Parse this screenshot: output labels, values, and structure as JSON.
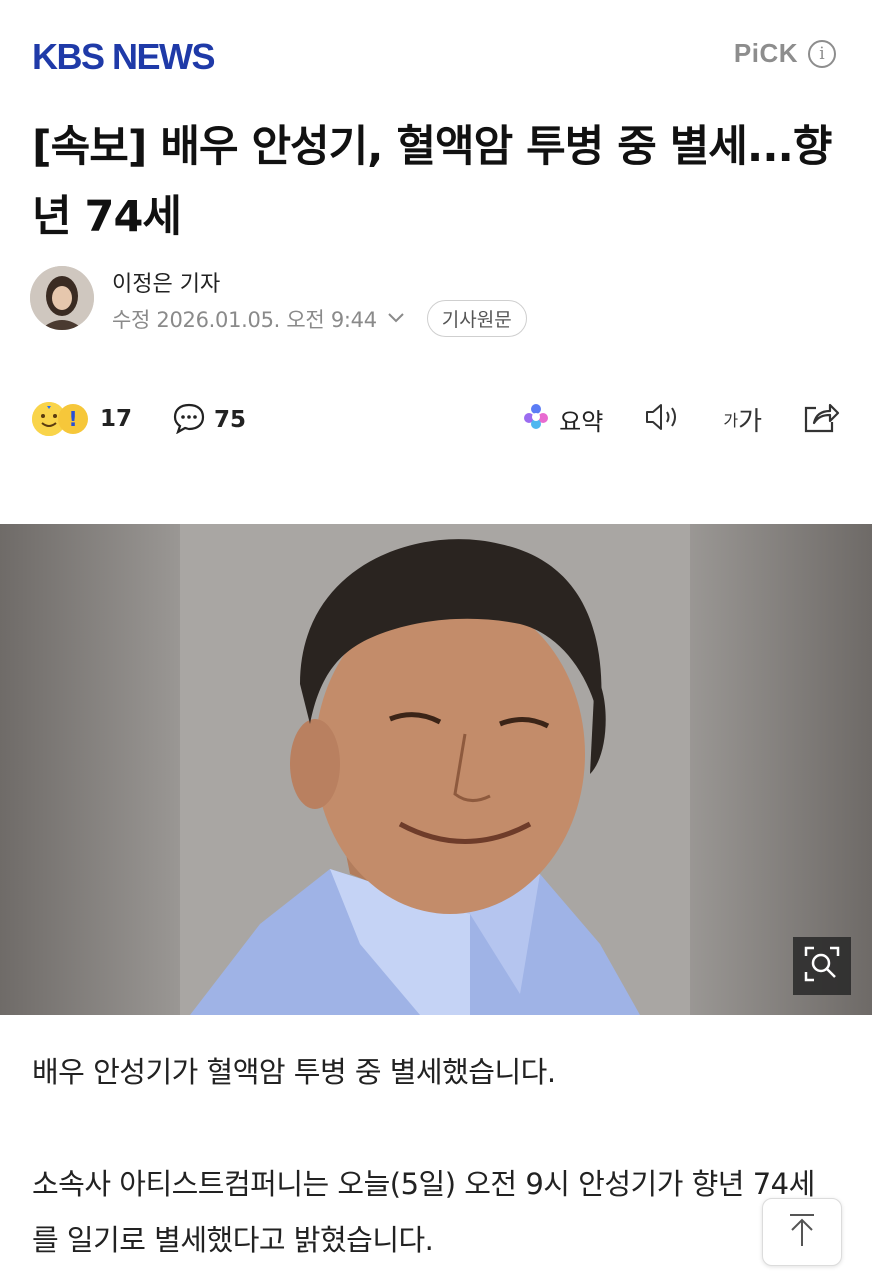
{
  "header": {
    "logo": "KBS NEWS",
    "pick_label": "PiCK",
    "info_icon": "info-icon"
  },
  "article": {
    "headline": "[속보] 배우 안성기, 혈액암 투병 중 별세...향년 74세",
    "reporter": "이정은 기자",
    "modified": "수정 2026.01.05. 오전 9:44",
    "origin_button": "기사원문"
  },
  "actions": {
    "reaction_count": "17",
    "comment_count": "75",
    "summary_label": "요약",
    "font_small": "가",
    "font_large": "가",
    "icons": [
      "reaction-emoji-icon",
      "comment-icon",
      "ai-summary-icon",
      "speaker-icon",
      "share-icon"
    ]
  },
  "photo": {
    "zoom_icon": "zoom-icon"
  },
  "body": {
    "paragraphs": [
      "배우 안성기가 혈액암 투병 중 별세했습니다.",
      "소속사 아티스트컴퍼니는 오늘(5일) 오전 9시 안성기가 향년 74세를 일기로 별세했다고 밝혔습니다."
    ]
  },
  "floating": {
    "top_icon": "arrow-up-icon"
  },
  "colors": {
    "brand": "#1f3aa8",
    "muted": "#8a8a8a"
  }
}
